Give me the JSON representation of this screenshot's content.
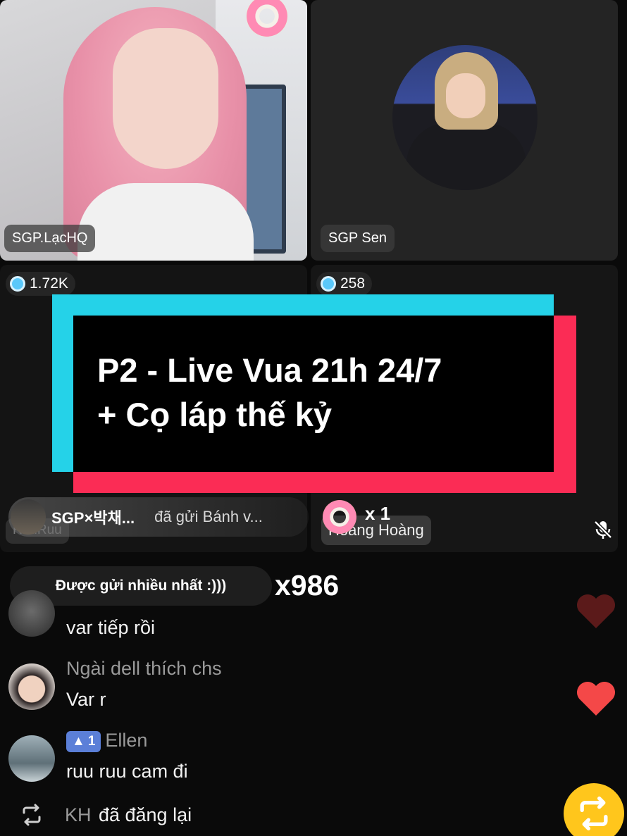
{
  "tiles": {
    "top_left": {
      "name": "SGP.LạcHQ"
    },
    "top_right": {
      "name": "SGP Sen"
    },
    "bottom_left": {
      "count": "1.72K",
      "name": "RuuRuu"
    },
    "bottom_right": {
      "count": "258",
      "name": "Hoàng Hoàng",
      "mic": "muted-mic-icon"
    }
  },
  "banner": {
    "line1": "P2 - Live Vua 21h 24/7",
    "line2": "+ Cọ láp thế kỷ",
    "colors": {
      "cyan": "#25d2e8",
      "red": "#fb2c55",
      "fill": "#000000"
    }
  },
  "gift": {
    "user": "SGP×박채...",
    "message": "đã gửi Bánh v...",
    "count": "x 1",
    "icon": "donut-gift-icon"
  },
  "most_sent": {
    "label": "Được gửi nhiều nhất :)))",
    "count": "x986"
  },
  "comments": [
    {
      "name": "",
      "text": "var tiếp rồi"
    },
    {
      "name": "Ngài dell thích chs",
      "text": "Var r"
    },
    {
      "name": "Ellen",
      "level": "1",
      "text": "ruu ruu cam đi"
    }
  ],
  "repost": {
    "name": "KH",
    "text": "đã đăng lại"
  },
  "colors": {
    "heart": "#f44848",
    "heart_dim": "#5b1a1a",
    "repost_button": "#ffc61c",
    "level_badge": "#5b7fd8"
  }
}
